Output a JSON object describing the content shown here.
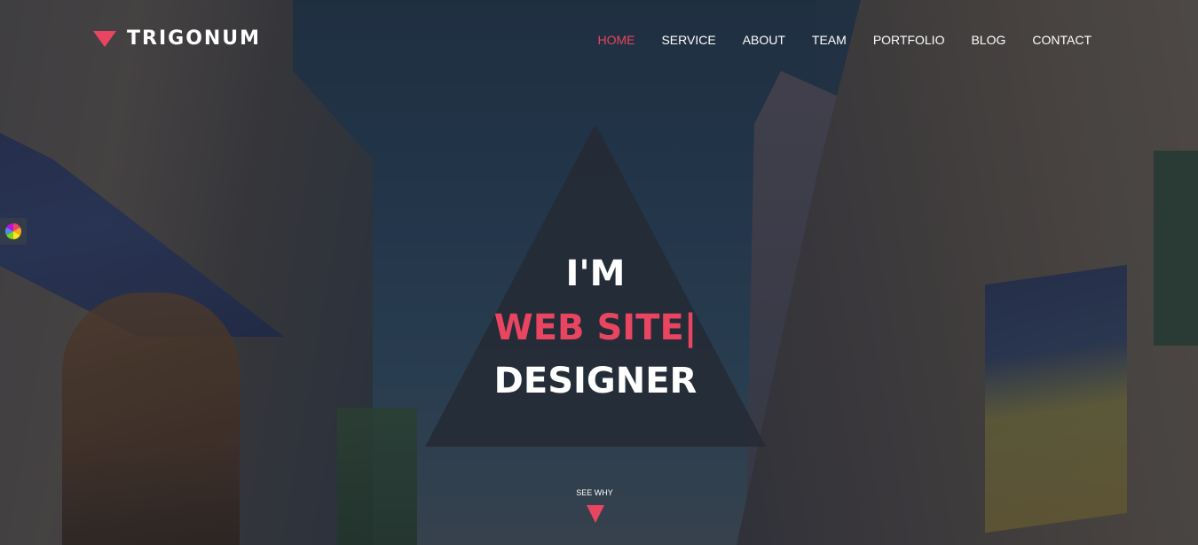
{
  "brand": {
    "name": "TRIGONUM",
    "accent": "#e94560"
  },
  "nav": {
    "items": [
      {
        "label": "HOME",
        "active": true
      },
      {
        "label": "SERVICE"
      },
      {
        "label": "ABOUT"
      },
      {
        "label": "TEAM"
      },
      {
        "label": "PORTFOLIO"
      },
      {
        "label": "BLOG"
      },
      {
        "label": "CONTACT"
      }
    ]
  },
  "hero": {
    "line1": "I'M",
    "line2": "WEB SITE|",
    "line3": "DESIGNER"
  },
  "scroll_cta": {
    "label": "SEE WHY",
    "icon": "triangle-down-icon"
  },
  "side_widget": {
    "icon": "color-wheel-icon"
  }
}
